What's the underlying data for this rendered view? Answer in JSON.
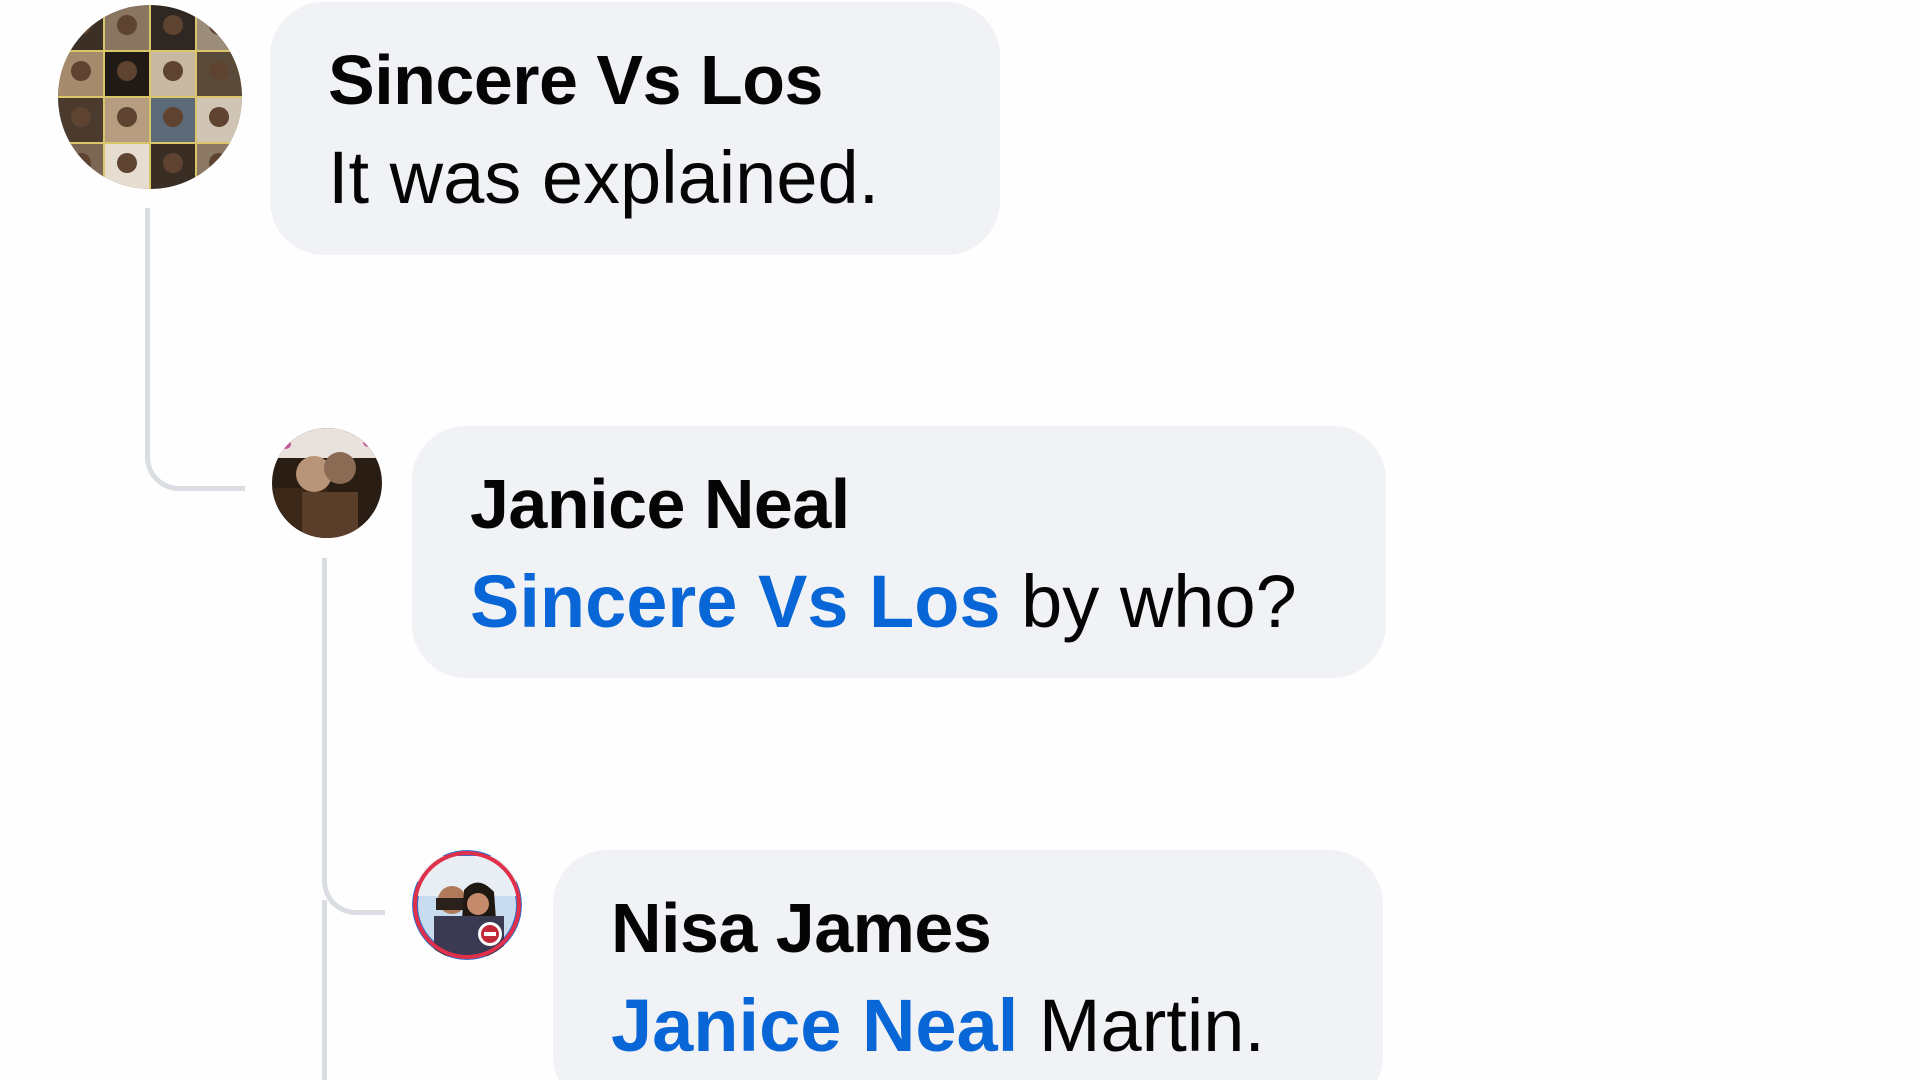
{
  "comments": [
    {
      "author": "Sincere Vs Los",
      "text": "It was explained.",
      "avatar_icon": "profile-photo-collage"
    },
    {
      "author": "Janice Neal",
      "mention": "Sincere Vs Los",
      "text": " by who?",
      "avatar_icon": "profile-photo"
    },
    {
      "author": "Nisa James",
      "mention": "Janice Neal",
      "text": " Martin.",
      "avatar_icon": "profile-photo-couple"
    }
  ],
  "colors": {
    "bubble": "#f0f2f5",
    "mention": "#0866d6",
    "text": "#050505",
    "thread_line": "#dadde1"
  }
}
